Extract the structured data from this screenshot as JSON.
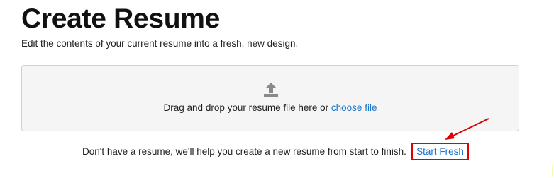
{
  "header": {
    "title": "Create Resume",
    "subtitle": "Edit the contents of your current resume into a fresh, new design."
  },
  "dropzone": {
    "icon": "upload-icon",
    "prompt": "Drag and drop your resume file here or ",
    "link_label": "choose file"
  },
  "footer": {
    "prompt": "Don't have a resume, we'll help you create a new resume from start to finish.",
    "start_fresh_label": "Start Fresh"
  },
  "annotation": {
    "highlight_color": "#e00000"
  },
  "colors": {
    "link": "#1a73c7",
    "dropzone_bg": "#f5f5f5",
    "icon": "#8a8a8a"
  }
}
